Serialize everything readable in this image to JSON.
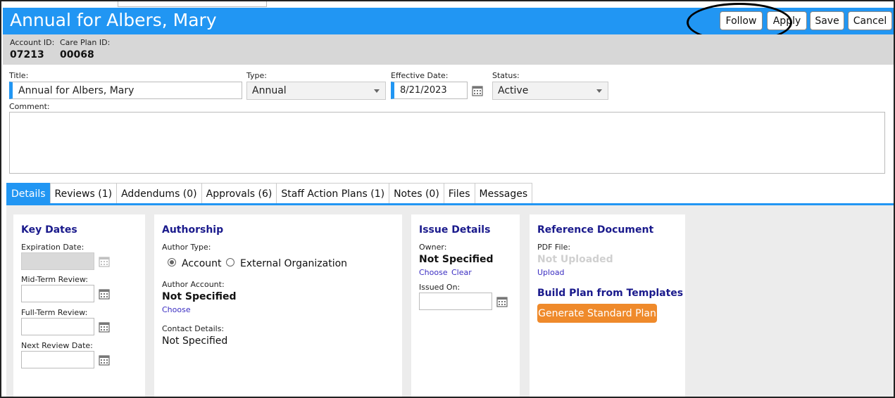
{
  "header": {
    "title": "Annual for Albers, Mary",
    "buttons": {
      "follow": "Follow",
      "apply": "Apply",
      "save": "Save",
      "cancel": "Cancel"
    }
  },
  "ids": {
    "account_label": "Account ID:",
    "account_value": "07213",
    "careplan_label": "Care Plan ID:",
    "careplan_value": "00068"
  },
  "form": {
    "title_label": "Title:",
    "title_value": "Annual for Albers, Mary",
    "type_label": "Type:",
    "type_value": "Annual",
    "effective_label": "Effective Date:",
    "effective_value": "8/21/2023",
    "status_label": "Status:",
    "status_value": "Active",
    "comment_label": "Comment:"
  },
  "tabs": [
    "Details",
    "Reviews (1)",
    "Addendums (0)",
    "Approvals (6)",
    "Staff Action Plans (1)",
    "Notes (0)",
    "Files",
    "Messages"
  ],
  "key_dates": {
    "title": "Key Dates",
    "expiration_label": "Expiration Date:",
    "midterm_label": "Mid-Term Review:",
    "fullterm_label": "Full-Term Review:",
    "next_label": "Next Review Date:"
  },
  "authorship": {
    "title": "Authorship",
    "author_type_label": "Author Type:",
    "option_account": "Account",
    "option_external": "External Organization",
    "author_account_label": "Author Account:",
    "author_account_value": "Not Specified",
    "choose_link": "Choose",
    "contact_label": "Contact Details:",
    "contact_value": "Not Specified"
  },
  "issue": {
    "title": "Issue Details",
    "owner_label": "Owner:",
    "owner_value": "Not Specified",
    "choose_link": "Choose",
    "clear_link": "Clear",
    "issued_label": "Issued On:"
  },
  "reference": {
    "title": "Reference Document",
    "pdf_label": "PDF File:",
    "pdf_value": "Not Uploaded",
    "upload_link": "Upload",
    "build_title": "Build Plan from Templates",
    "generate_button": "Generate Standard Plan"
  },
  "colors": {
    "accent": "#2196f3",
    "orange": "#ef8a2b",
    "panel_title": "#1a1a8c"
  },
  "icons": {
    "calendar": "calendar-icon"
  }
}
